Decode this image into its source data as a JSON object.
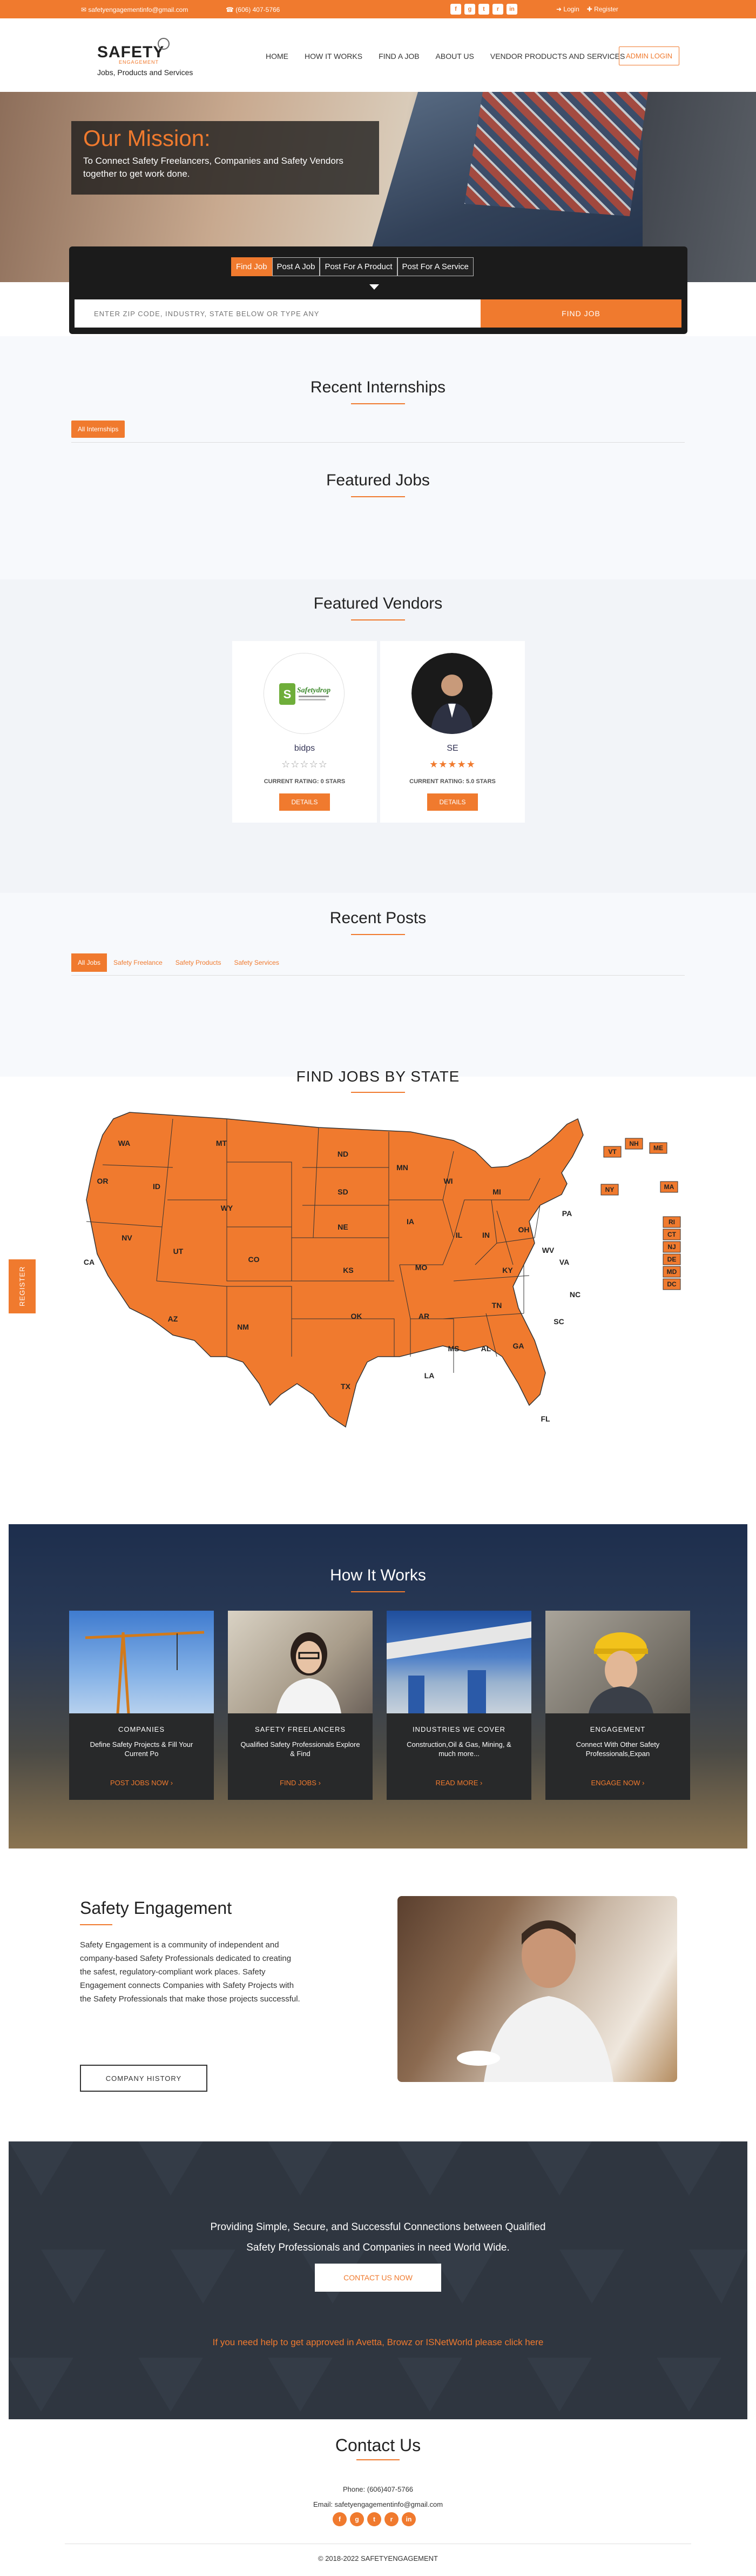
{
  "topbar": {
    "email": "safetyengagementinfo@gmail.com",
    "phone": "(606) 407-5766",
    "socials": [
      "f",
      "g",
      "t",
      "r",
      "in"
    ],
    "login": "Login",
    "register": "Register"
  },
  "header": {
    "logo_text": "SAFETY",
    "logo_small": "ENGAGEMENT",
    "tagline": "Jobs, Products and Services",
    "nav": [
      "HOME",
      "HOW IT WORKS",
      "FIND A JOB",
      "ABOUT US",
      "VENDOR PRODUCTS AND SERVICES"
    ],
    "admin_login": "ADMIN LOGIN"
  },
  "hero": {
    "mission_title": "Our Mission:",
    "mission_text": "To Connect Safety Freelancers, Companies and Safety Vendors together to get work done."
  },
  "search": {
    "tabs": [
      "Find Job",
      "Post A Job",
      "Post For A Product",
      "Post For A Service"
    ],
    "placeholder": "ENTER ZIP CODE, INDUSTRY, STATE BELOW OR TYPE ANY",
    "button": "FIND JOB"
  },
  "internships": {
    "title": "Recent Internships",
    "pill": "All Internships"
  },
  "featured_jobs": {
    "title": "Featured Jobs"
  },
  "featured_vendors": {
    "title": "Featured Vendors",
    "vendors": [
      {
        "name": "bidps",
        "stars": "☆☆☆☆☆",
        "rating": "CURRENT RATING: 0 STARS",
        "button": "DETAILS",
        "logo_text": "Safetydrop"
      },
      {
        "name": "SE",
        "stars": "★★★★★",
        "rating": "CURRENT RATING: 5.0 STARS",
        "button": "DETAILS"
      }
    ]
  },
  "recent_posts": {
    "title": "Recent Posts",
    "tabs": [
      "All Jobs",
      "Safety Freelance",
      "Safety Products",
      "Safety Services"
    ]
  },
  "jobs_by_state": {
    "title": "FIND JOBS BY STATE",
    "states": [
      "WA",
      "OR",
      "CA",
      "ID",
      "NV",
      "MT",
      "WY",
      "UT",
      "AZ",
      "CO",
      "NM",
      "ND",
      "SD",
      "NE",
      "KS",
      "OK",
      "TX",
      "MN",
      "IA",
      "MO",
      "AR",
      "LA",
      "WI",
      "IL",
      "MS",
      "MI",
      "IN",
      "KY",
      "TN",
      "AL",
      "OH",
      "GA",
      "FL",
      "WV",
      "VA",
      "NC",
      "SC",
      "PA",
      "NY",
      "VT",
      "NH",
      "ME",
      "MA",
      "RI",
      "CT",
      "NJ",
      "DE",
      "MD",
      "DC"
    ]
  },
  "register_tab": "REGISTER",
  "how_it_works": {
    "title": "How It Works",
    "cards": [
      {
        "head": "COMPANIES",
        "desc": "Define Safety Projects & Fill Your Current Po",
        "link": "POST JOBS NOW ›"
      },
      {
        "head": "SAFETY FREELANCERS",
        "desc": "Qualified Safety Professionals Explore & Find",
        "link": "FIND JOBS ›"
      },
      {
        "head": "INDUSTRIES WE COVER",
        "desc": "Construction,Oil & Gas, Mining, & much more...",
        "link": "READ MORE ›"
      },
      {
        "head": "ENGAGEMENT",
        "desc": "Connect With Other Safety Professionals,Expan",
        "link": "ENGAGE NOW ›"
      }
    ]
  },
  "safety_engagement": {
    "title": "Safety Engagement",
    "text": "Safety Engagement is a community of independent and company-based Safety Professionals dedicated to creating the safest, regulatory-compliant work places. Safety Engagement connects Companies with Safety Projects with the Safety Professionals that make those projects successful.",
    "button": "COMPANY HISTORY"
  },
  "cta": {
    "line1": "Providing Simple, Secure, and Successful Connections between Qualified",
    "line2": "Safety Professionals and Companies in need World Wide.",
    "button": "CONTACT US NOW",
    "help_link": "If you need help to get approved in Avetta, Browz or ISNetWorld please click here"
  },
  "contact": {
    "title": "Contact Us",
    "phone": "Phone: (606)407-5766",
    "email": "Email: safetyengagementinfo@gmail.com",
    "socials": [
      "f",
      "g",
      "t",
      "r",
      "in"
    ]
  },
  "footer": {
    "copyright": "© 2018-2022 SAFETYENGAGEMENT"
  },
  "colors": {
    "accent": "#f07a2e",
    "dark": "#1b1b1b"
  }
}
